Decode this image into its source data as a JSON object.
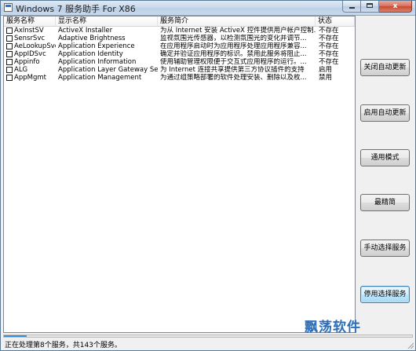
{
  "window": {
    "title": "Windows 7 服务助手 For X86",
    "minimize_glyph": "",
    "maximize_glyph": "",
    "close_glyph": "x"
  },
  "list": {
    "columns": [
      "服务名称",
      "显示名称",
      "服务简介",
      "状态"
    ],
    "rows": [
      {
        "name": "AxInstSV",
        "display": "ActiveX Installer",
        "desc": "为从 Internet 安装 ActiveX 控件提供用户帐户控制...",
        "status": "不存在"
      },
      {
        "name": "SensrSvc",
        "display": "Adaptive Brightness",
        "desc": "监视氛围光传感器，以检测氛围光的变化并调节...",
        "status": "不存在"
      },
      {
        "name": "AeLookupSvc",
        "display": "Application Experience",
        "desc": "在应用程序启动时为应用程序处理应用程序兼容...",
        "status": "不存在"
      },
      {
        "name": "AppIDSvc",
        "display": "Application Identity",
        "desc": "确定并验证应用程序的标识。禁用此服务将阻止...",
        "status": "不存在"
      },
      {
        "name": "Appinfo",
        "display": "Application Information",
        "desc": "使用辅助管理权限便于交互式应用程序的运行。...",
        "status": "不存在"
      },
      {
        "name": "ALG",
        "display": "Application Layer Gateway Service",
        "desc": "为 Internet 连接共享提供第三方协议插件的支持",
        "status": "启用"
      },
      {
        "name": "AppMgmt",
        "display": "Application Management",
        "desc": "为通过组策略部署的软件处理安装、删除以及枚...",
        "status": "禁用"
      }
    ]
  },
  "buttons": [
    {
      "label": "关闭自动更新"
    },
    {
      "label": "启用自动更新"
    },
    {
      "label": "通用模式"
    },
    {
      "label": "最精简"
    },
    {
      "label": "手动选择服务"
    },
    {
      "label": "停用选择服务"
    }
  ],
  "status": {
    "text": "正在处理第8个服务，共143个服务。",
    "progress_fraction": 0.056
  },
  "watermark": "飘荡软件"
}
